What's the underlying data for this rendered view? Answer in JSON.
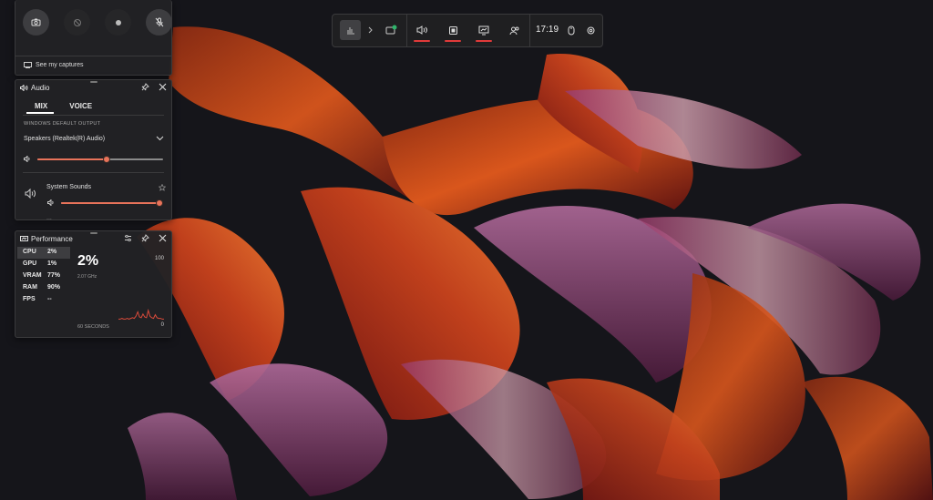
{
  "gamebar": {
    "clock": "17:19",
    "accent": "#e03a3a",
    "widgets": [
      {
        "name": "widget-menu-icon"
      },
      {
        "name": "chevron-right-icon"
      },
      {
        "name": "capture-widget-icon"
      },
      {
        "name": "audio-widget-icon"
      },
      {
        "name": "performance-widget-icon"
      },
      {
        "name": "resources-widget-icon"
      },
      {
        "name": "social-widget-icon"
      },
      {
        "name": "mouse-icon"
      },
      {
        "name": "settings-gear-icon"
      }
    ]
  },
  "capture": {
    "buttons": [
      "camera-icon",
      "record-last-icon",
      "record-dot-icon",
      "mic-muted-icon"
    ],
    "see_captures": "See my captures"
  },
  "audio": {
    "title": "Audio",
    "tabs": [
      "MIX",
      "VOICE"
    ],
    "active_tab": "MIX",
    "section_label": "WINDOWS DEFAULT OUTPUT",
    "device": "Speakers (Realtek(R) Audio)",
    "master_volume": 0.55,
    "apps": [
      {
        "name": "System Sounds",
        "volume": 1.0
      }
    ],
    "next_app_partial": "...",
    "slider_color": "#e8735a"
  },
  "performance": {
    "title": "Performance",
    "metrics": [
      {
        "key": "CPU",
        "value": "2%"
      },
      {
        "key": "GPU",
        "value": "1%"
      },
      {
        "key": "VRAM",
        "value": "77%"
      },
      {
        "key": "RAM",
        "value": "90%"
      },
      {
        "key": "FPS",
        "value": "--"
      }
    ],
    "selected_metric": "CPU",
    "big_value": "2%",
    "frequency": "2.07 GHz",
    "scale_max": "100",
    "scale_min": "0",
    "window_label": "60 SECONDS",
    "graph_color": "#d84a3a",
    "graph_values": [
      2,
      2,
      3,
      2,
      2,
      3,
      2,
      3,
      4,
      3,
      6,
      12,
      5,
      4,
      9,
      5,
      4,
      14,
      6,
      4,
      3,
      8,
      4,
      3,
      3,
      2,
      2
    ]
  }
}
